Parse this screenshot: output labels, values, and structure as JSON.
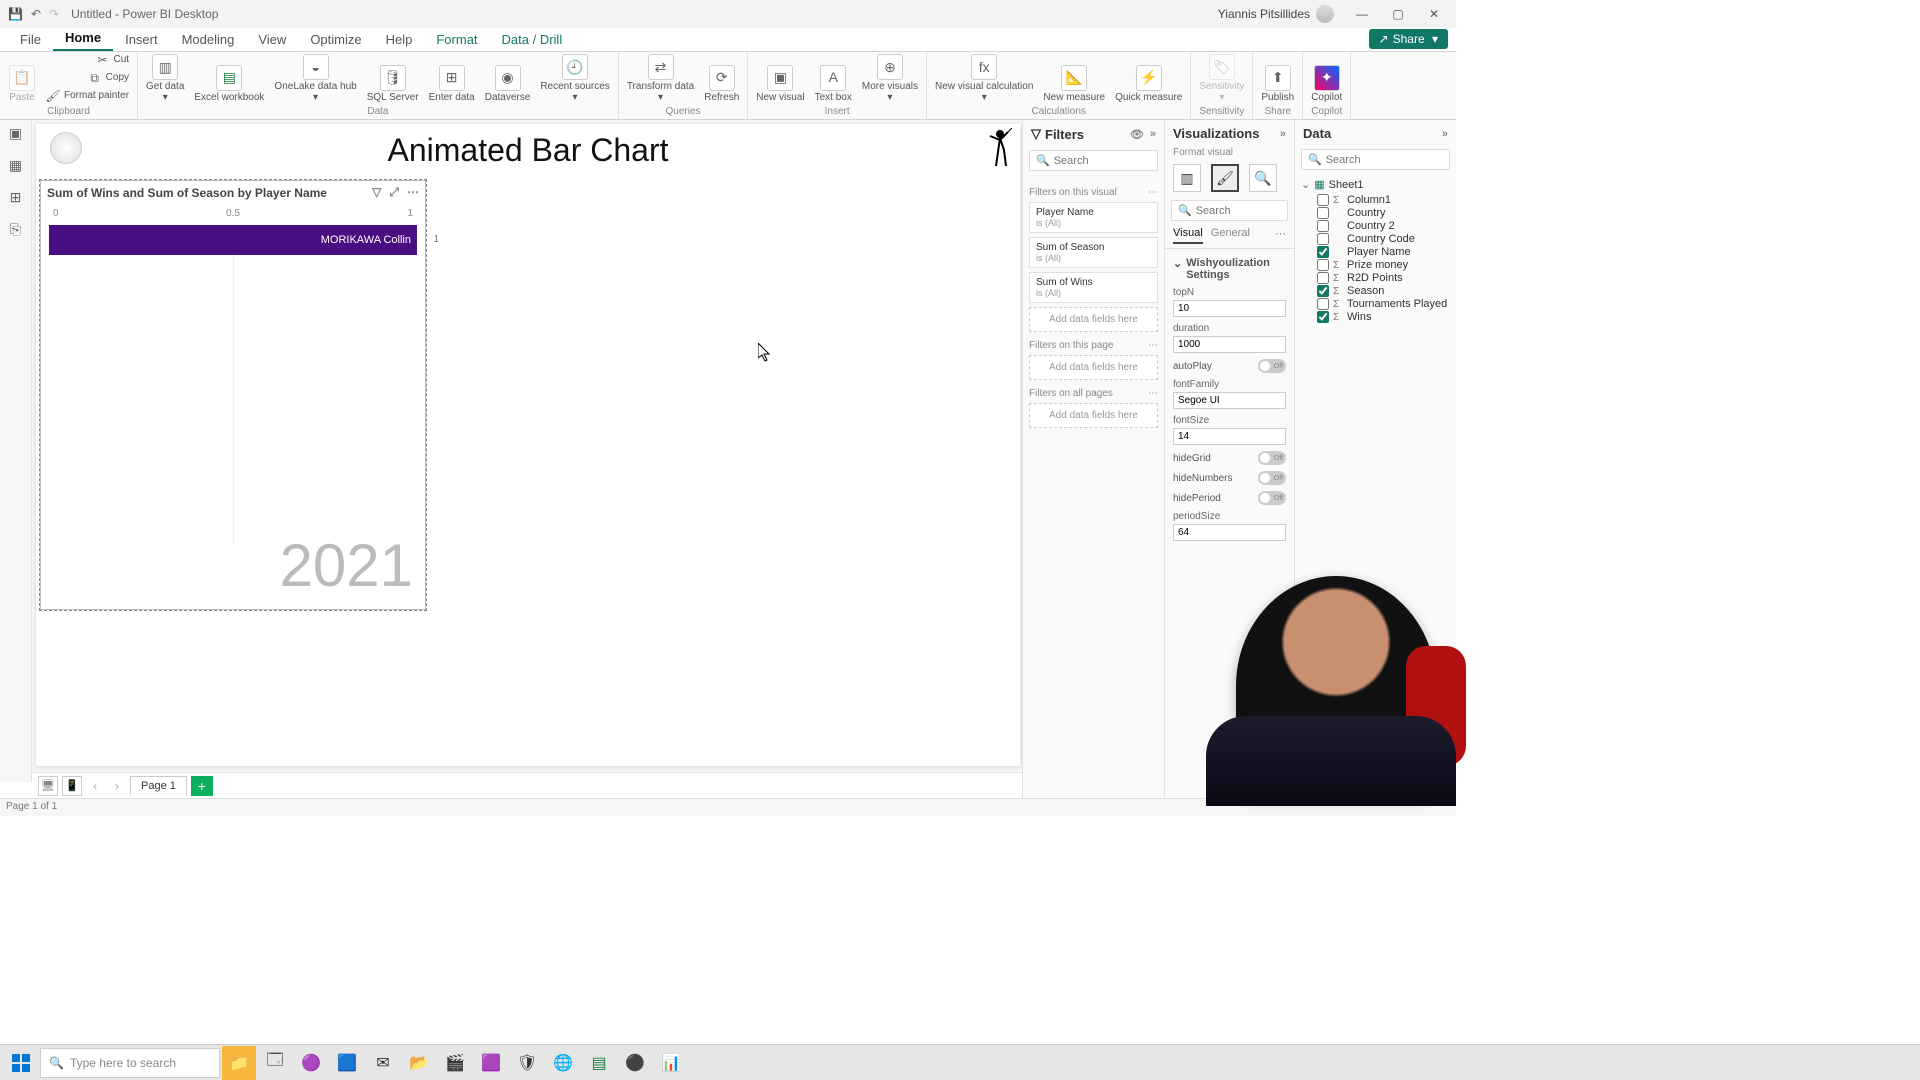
{
  "title": "Untitled - Power BI Desktop",
  "user_name": "Yiannis Pitsillides",
  "menu": {
    "file": "File",
    "home": "Home",
    "insert": "Insert",
    "modeling": "Modeling",
    "view": "View",
    "optimize": "Optimize",
    "help": "Help",
    "format": "Format",
    "datadrill": "Data / Drill",
    "share": "Share"
  },
  "ribbon": {
    "clipboard": {
      "cut": "Cut",
      "copy": "Copy",
      "painter": "Format painter",
      "group": "Clipboard"
    },
    "data": {
      "get": "Get data",
      "excel": "Excel workbook",
      "onelake": "OneLake data hub",
      "sql": "SQL Server",
      "enter": "Enter data",
      "dataverse": "Dataverse",
      "recent": "Recent sources",
      "group": "Data"
    },
    "queries": {
      "transform": "Transform data",
      "refresh": "Refresh",
      "group": "Queries"
    },
    "insert": {
      "visual": "New visual",
      "text": "Text box",
      "more": "More visuals",
      "group": "Insert"
    },
    "calc": {
      "newcalc": "New visual calculation",
      "measure": "New measure",
      "quick": "Quick measure",
      "group": "Calculations"
    },
    "sens": {
      "label": "Sensitivity",
      "group": "Sensitivity"
    },
    "share": {
      "publish": "Publish",
      "group": "Share"
    },
    "copilot": {
      "label": "Copilot",
      "group": "Copilot"
    }
  },
  "canvas": {
    "title": "Animated Bar Chart",
    "visual_title": "Sum of Wins and Sum of Season by Player Name",
    "period": "2021"
  },
  "chart_data": {
    "type": "bar",
    "categories": [
      "MORIKAWA Collin"
    ],
    "values": [
      1
    ],
    "xlim": [
      0,
      1
    ],
    "xticks": [
      0,
      0.5,
      1
    ],
    "title": "Sum of Wins and Sum of Season by Player Name",
    "xlabel": "",
    "ylabel": "",
    "period_label": "2021"
  },
  "pages": {
    "page1": "Page 1",
    "status": "Page 1 of 1"
  },
  "filters": {
    "title": "Filters",
    "search_ph": "Search",
    "on_visual": "Filters on this visual",
    "on_page": "Filters on this page",
    "on_all": "Filters on all pages",
    "add": "Add data fields here",
    "cards": [
      {
        "name": "Player Name",
        "val": "is (All)"
      },
      {
        "name": "Sum of Season",
        "val": "is (All)"
      },
      {
        "name": "Sum of Wins",
        "val": "is (All)"
      }
    ]
  },
  "viz": {
    "title": "Visualizations",
    "sub": "Format visual",
    "search_ph": "Search",
    "tab_visual": "Visual",
    "tab_general": "General",
    "group": "Wishyoulization Settings",
    "settings": {
      "topN_l": "topN",
      "topN_v": "10",
      "duration_l": "duration",
      "duration_v": "1000",
      "autoPlay_l": "autoPlay",
      "fontFamily_l": "fontFamily",
      "fontFamily_v": "Segoe UI",
      "fontSize_l": "fontSize",
      "fontSize_v": "14",
      "hideGrid_l": "hideGrid",
      "hideNumbers_l": "hideNumbers",
      "hidePeriod_l": "hidePeriod",
      "periodSize_l": "periodSize",
      "periodSize_v": "64",
      "toggle_off": "Off"
    }
  },
  "data": {
    "title": "Data",
    "search_ph": "Search",
    "table": "Sheet1",
    "fields": [
      {
        "name": "Column1",
        "sigma": true,
        "checked": false
      },
      {
        "name": "Country",
        "sigma": false,
        "checked": false
      },
      {
        "name": "Country 2",
        "sigma": false,
        "checked": false
      },
      {
        "name": "Country Code",
        "sigma": false,
        "checked": false
      },
      {
        "name": "Player Name",
        "sigma": false,
        "checked": true
      },
      {
        "name": "Prize money",
        "sigma": true,
        "checked": false
      },
      {
        "name": "R2D Points",
        "sigma": true,
        "checked": false
      },
      {
        "name": "Season",
        "sigma": true,
        "checked": true
      },
      {
        "name": "Tournaments Played",
        "sigma": true,
        "checked": false
      },
      {
        "name": "Wins",
        "sigma": true,
        "checked": true
      }
    ]
  },
  "taskbar": {
    "search_ph": "Type here to search"
  }
}
